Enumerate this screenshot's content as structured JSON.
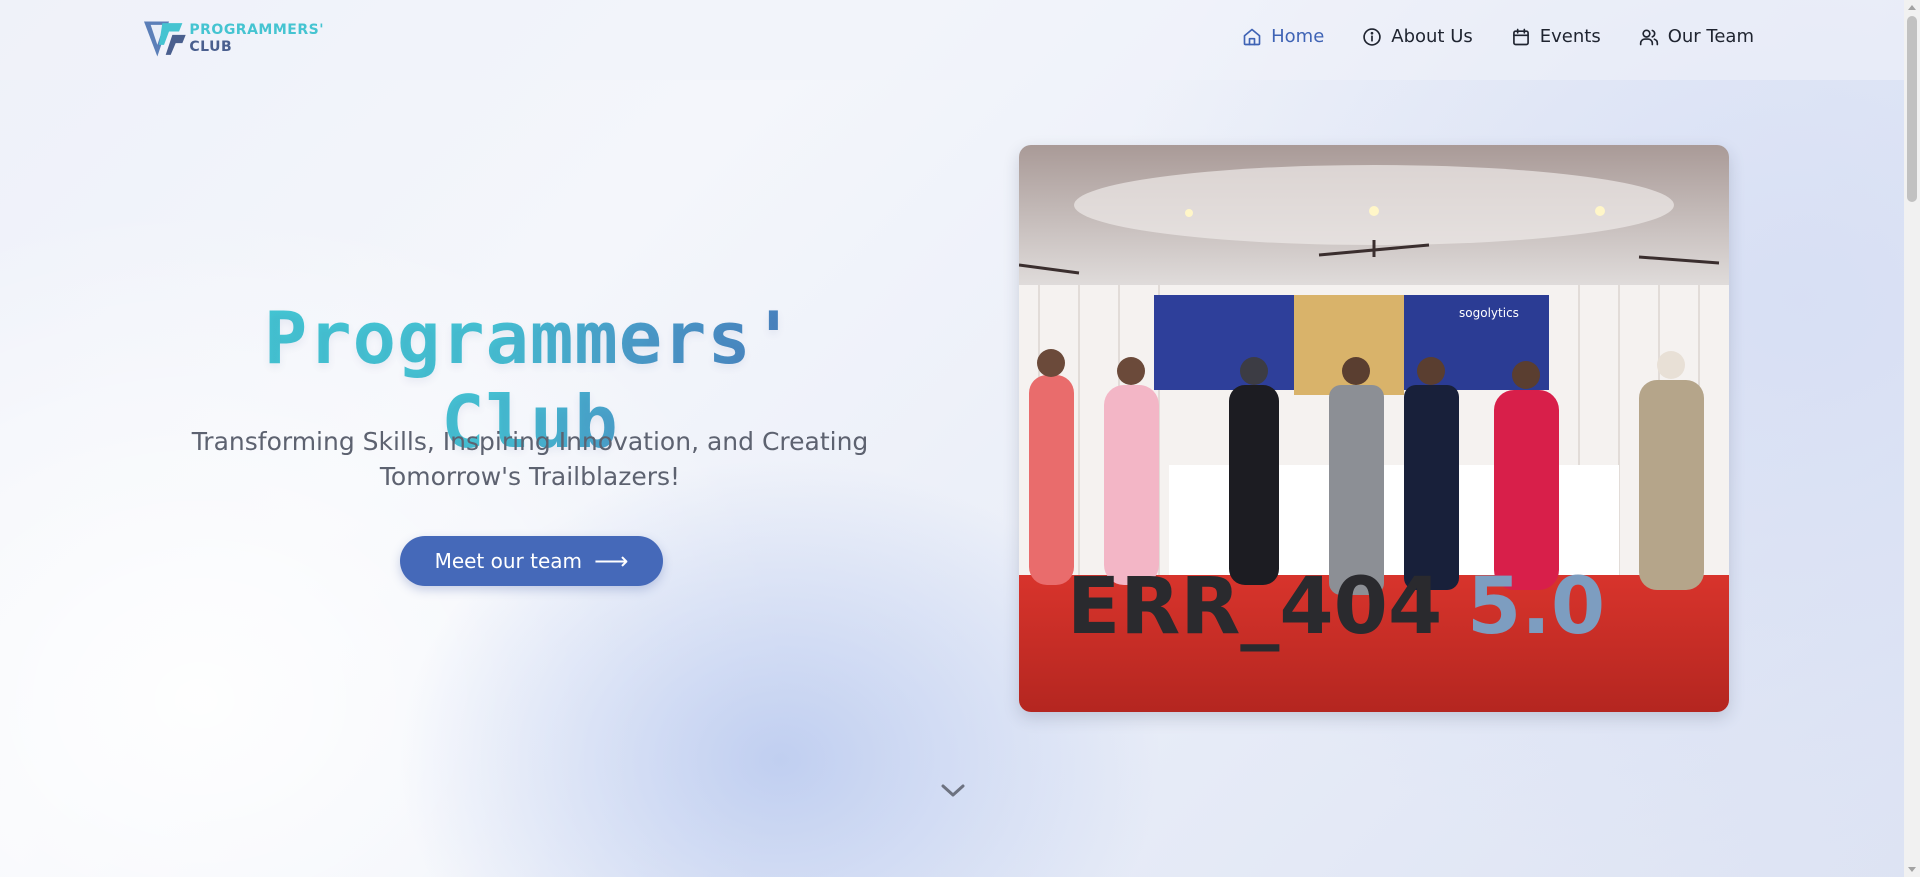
{
  "logo": {
    "line1": "PROGRAMMERS'",
    "line2": "CLUB",
    "icon": "pc-logo-icon"
  },
  "nav": {
    "items": [
      {
        "label": "Home",
        "icon": "home-icon",
        "active": true
      },
      {
        "label": "About Us",
        "icon": "info-icon",
        "active": false
      },
      {
        "label": "Events",
        "icon": "calendar-icon",
        "active": false
      },
      {
        "label": "Our Team",
        "icon": "users-icon",
        "active": false
      }
    ]
  },
  "hero": {
    "title": "Programmers' Club",
    "subtitle": "Transforming Skills, Inspiring Innovation, and Creating Tomorrow's Trailblazers!",
    "cta_label": "Meet our team",
    "cta_arrow": "⟶",
    "photo": {
      "stage_letters": "ERR_404",
      "stage_version": "5.0",
      "banner_text": "sogolytics"
    }
  },
  "colors": {
    "accent": "#4569b9",
    "nav_active": "#3f63b5",
    "title_cyan": "#43c9d4",
    "title_blue": "#4770b7"
  }
}
